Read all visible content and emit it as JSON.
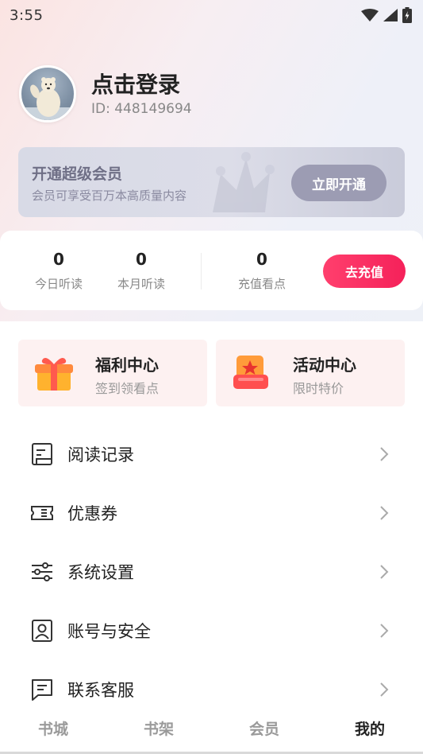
{
  "status_bar": {
    "time": "3:55"
  },
  "profile": {
    "title": "点击登录",
    "id_text": "ID: 448149694"
  },
  "vip": {
    "title": "开通超级会员",
    "subtitle": "会员可享受百万本高质量内容",
    "button": "立即开通"
  },
  "stats": {
    "items": [
      {
        "value": "0",
        "label": "今日听读"
      },
      {
        "value": "0",
        "label": "本月听读"
      },
      {
        "value": "0",
        "label": "充值看点"
      }
    ],
    "recharge_button": "去充值"
  },
  "promos": [
    {
      "title": "福利中心",
      "subtitle": "签到领看点",
      "icon": "gift-icon"
    },
    {
      "title": "活动中心",
      "subtitle": "限时特价",
      "icon": "star-box-icon"
    }
  ],
  "menu": [
    {
      "label": "阅读记录",
      "icon": "reading-record-icon"
    },
    {
      "label": "优惠券",
      "icon": "coupon-icon"
    },
    {
      "label": "系统设置",
      "icon": "settings-sliders-icon"
    },
    {
      "label": "账号与安全",
      "icon": "account-icon"
    },
    {
      "label": "联系客服",
      "icon": "message-icon"
    }
  ],
  "tabs": [
    {
      "label": "书城",
      "active": false
    },
    {
      "label": "书架",
      "active": false
    },
    {
      "label": "会员",
      "active": false
    },
    {
      "label": "我的",
      "active": true
    }
  ],
  "colors": {
    "accent": "#f5215a",
    "vip_button": "#9c9cb3",
    "promo_bg": "#fdf1f1"
  }
}
